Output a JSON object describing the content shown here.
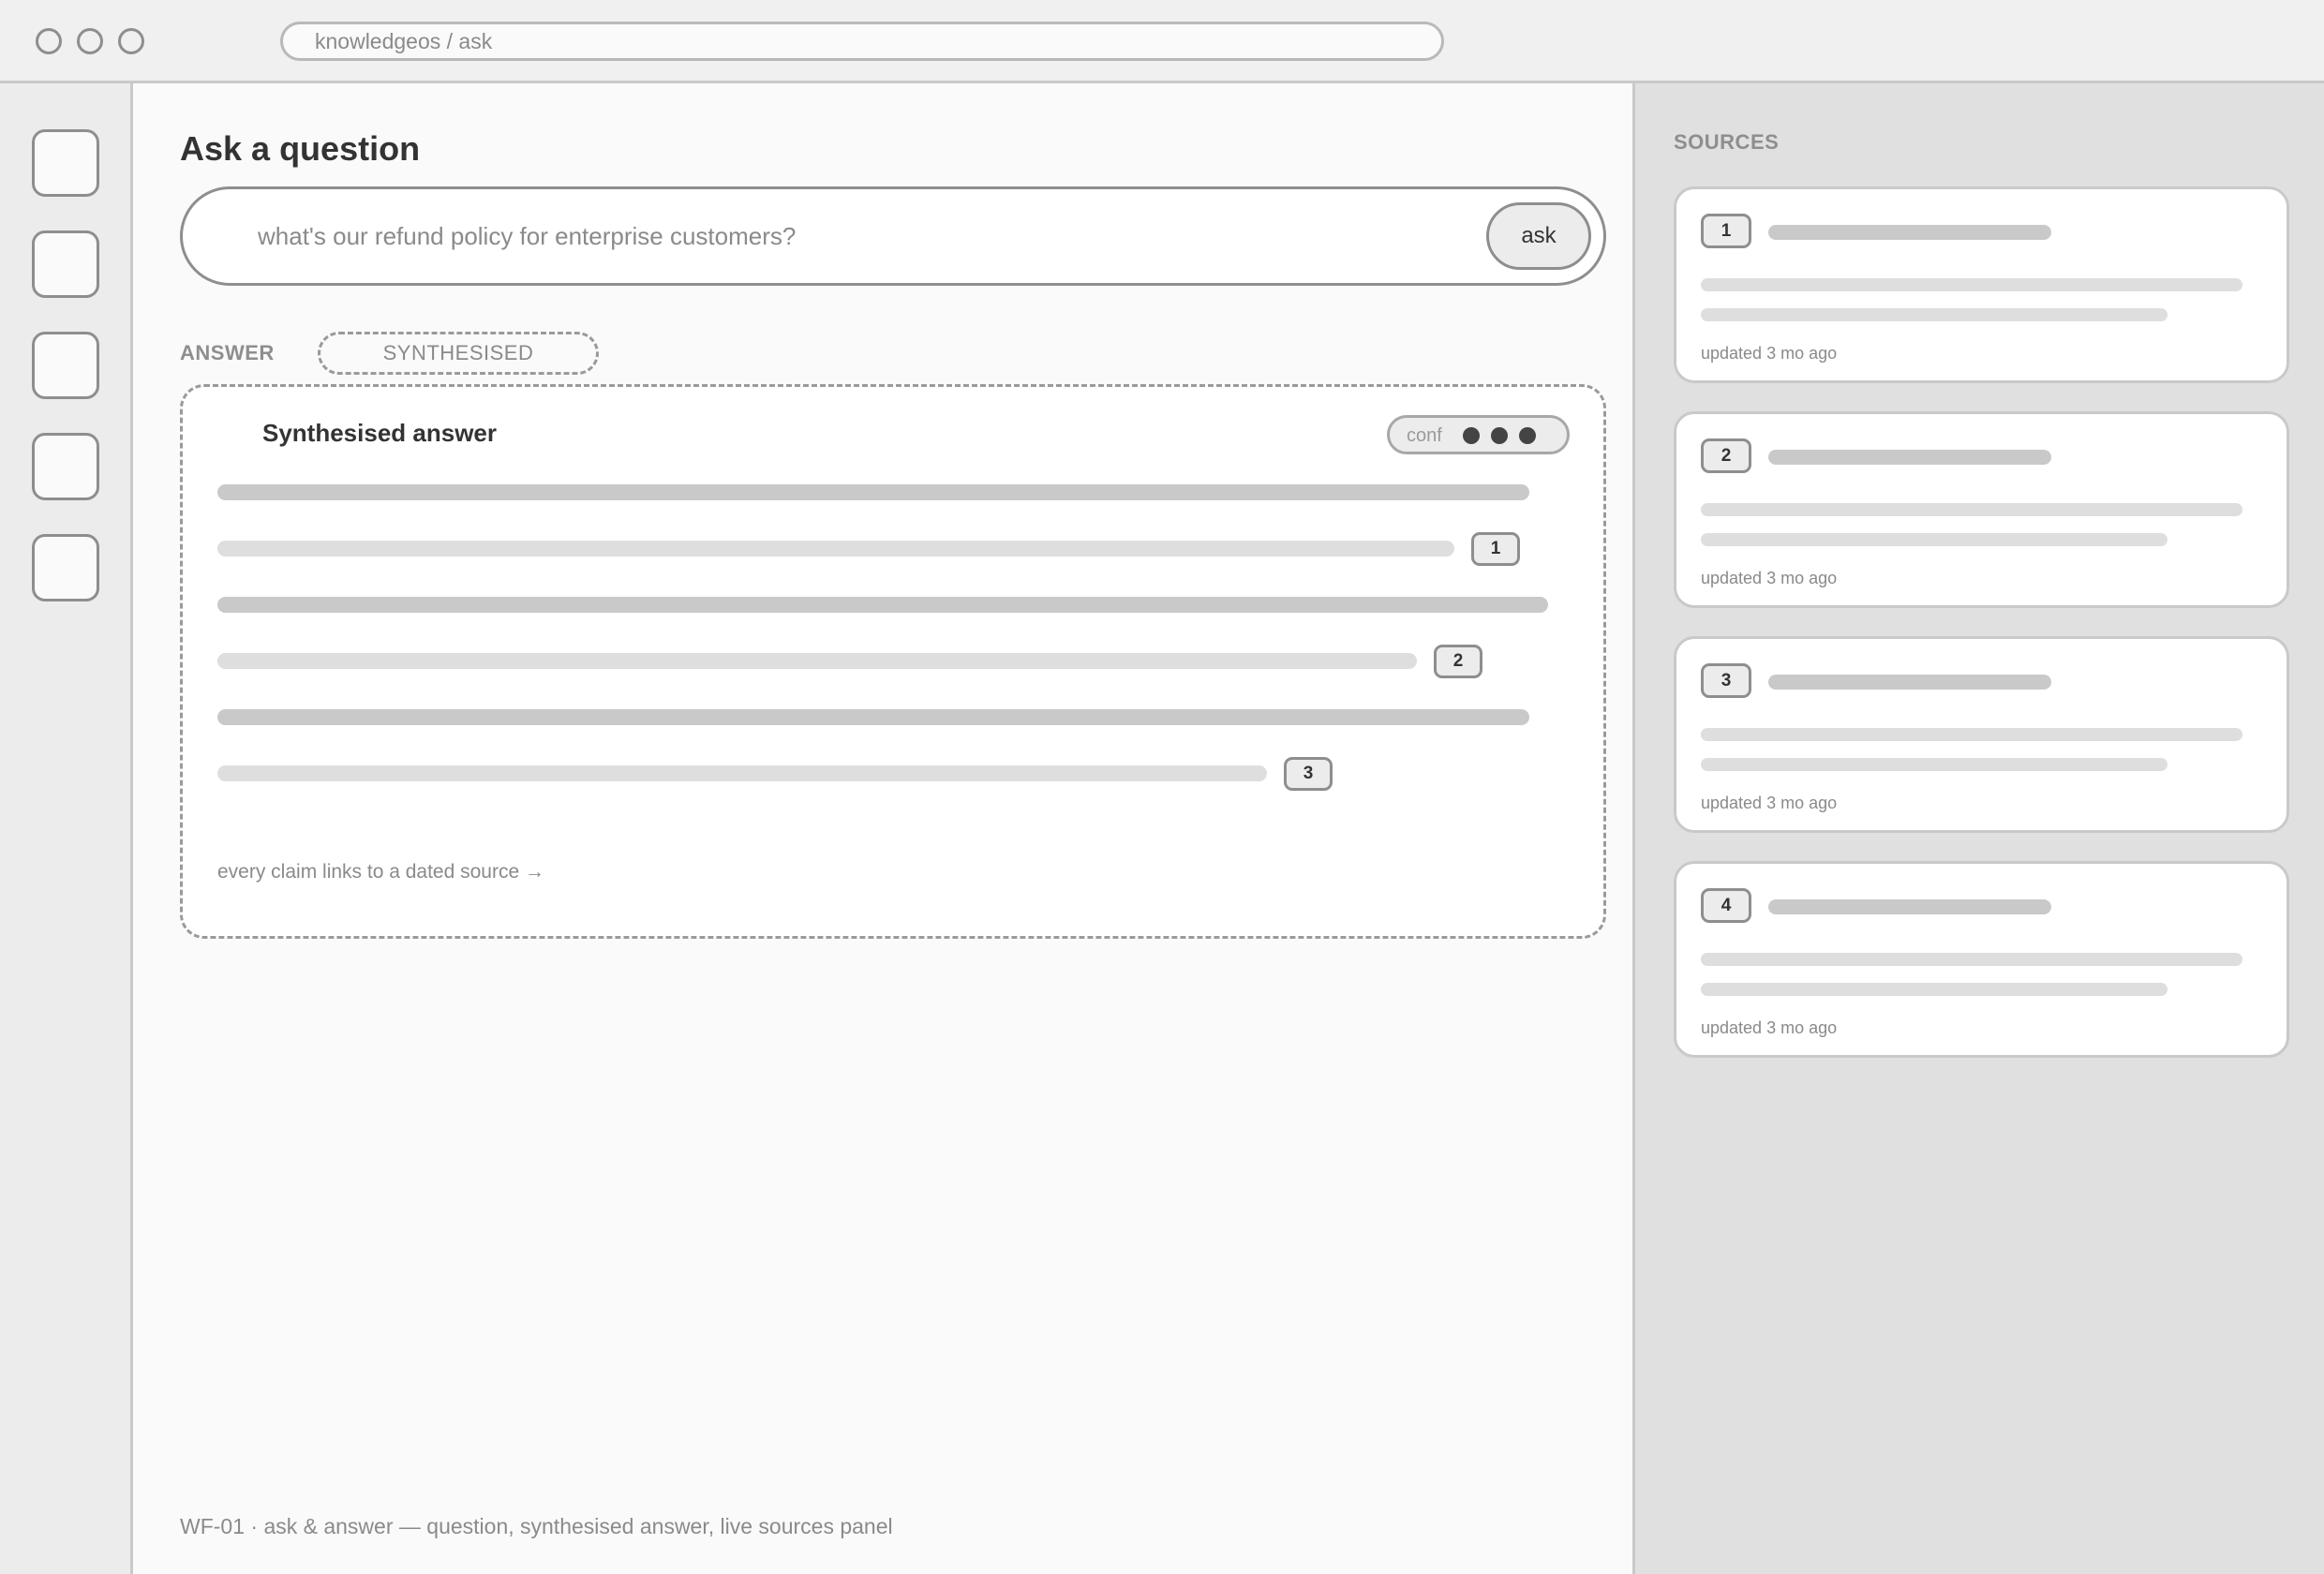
{
  "browser": {
    "url": "knowledgeos / ask"
  },
  "main": {
    "title": "Ask a question",
    "search": {
      "value": "what's our refund policy for enterprise customers?",
      "ask_label": "ask"
    },
    "answer_section_label": "ANSWER",
    "answer_tag": "SYNTHESISED",
    "answer": {
      "title": "Synthesised answer",
      "confidence_label": "conf",
      "confidence_dots": 3,
      "citations": [
        "1",
        "2",
        "3"
      ],
      "note": "every claim links to a dated source →"
    },
    "footer_caption": "WF-01 · ask & answer — question, synthesised answer, live sources panel"
  },
  "sources": {
    "title": "SOURCES",
    "items": [
      {
        "num": "1",
        "updated": "updated 3 mo ago"
      },
      {
        "num": "2",
        "updated": "updated 3 mo ago"
      },
      {
        "num": "3",
        "updated": "updated 3 mo ago"
      },
      {
        "num": "4",
        "updated": "updated 3 mo ago"
      }
    ]
  }
}
